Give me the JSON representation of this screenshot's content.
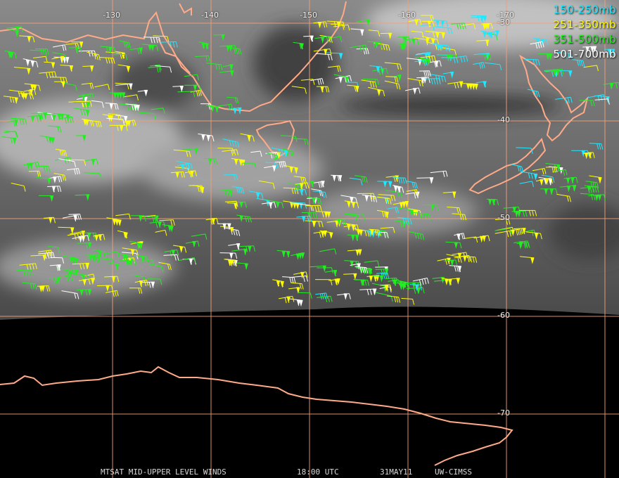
{
  "legend": [
    {
      "label": "150-250mb",
      "color": "#22e8ff"
    },
    {
      "label": "251-350mb",
      "color": "#ffff00"
    },
    {
      "label": "351-500mb",
      "color": "#22ee22"
    },
    {
      "label": "501-700mb",
      "color": "#ffffff"
    }
  ],
  "longitudes": [
    "-130",
    "-140",
    "-150",
    "-160",
    "-170"
  ],
  "latitudes": [
    "-30",
    "-40",
    "-50",
    "-60",
    "-70"
  ],
  "footer": {
    "product": "MTSAT MID-UPPER LEVEL WINDS",
    "time": "18:00 UTC",
    "date": "31MAY11",
    "source": "UW-CIMSS"
  },
  "colors": {
    "coastline": "#ffaa88",
    "grid": "#f4a07a",
    "background_space": "#000000"
  }
}
